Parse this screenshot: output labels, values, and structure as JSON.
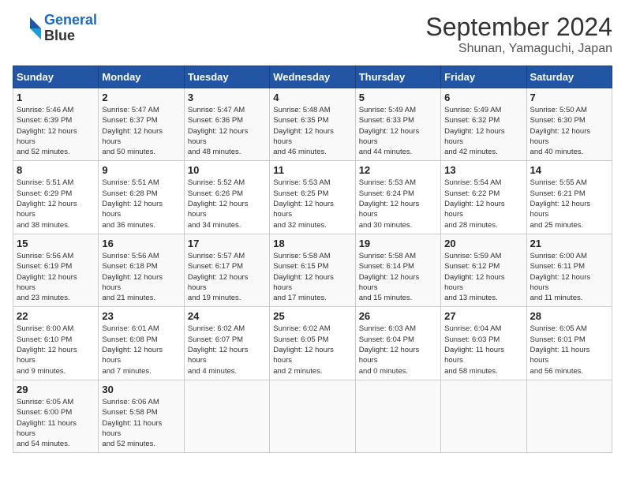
{
  "header": {
    "logo_line1": "General",
    "logo_line2": "Blue",
    "month": "September 2024",
    "location": "Shunan, Yamaguchi, Japan"
  },
  "weekdays": [
    "Sunday",
    "Monday",
    "Tuesday",
    "Wednesday",
    "Thursday",
    "Friday",
    "Saturday"
  ],
  "weeks": [
    [
      {
        "day": "1",
        "rise": "5:46 AM",
        "set": "6:39 PM",
        "daylight": "12 hours and 52 minutes."
      },
      {
        "day": "2",
        "rise": "5:47 AM",
        "set": "6:37 PM",
        "daylight": "12 hours and 50 minutes."
      },
      {
        "day": "3",
        "rise": "5:47 AM",
        "set": "6:36 PM",
        "daylight": "12 hours and 48 minutes."
      },
      {
        "day": "4",
        "rise": "5:48 AM",
        "set": "6:35 PM",
        "daylight": "12 hours and 46 minutes."
      },
      {
        "day": "5",
        "rise": "5:49 AM",
        "set": "6:33 PM",
        "daylight": "12 hours and 44 minutes."
      },
      {
        "day": "6",
        "rise": "5:49 AM",
        "set": "6:32 PM",
        "daylight": "12 hours and 42 minutes."
      },
      {
        "day": "7",
        "rise": "5:50 AM",
        "set": "6:30 PM",
        "daylight": "12 hours and 40 minutes."
      }
    ],
    [
      {
        "day": "8",
        "rise": "5:51 AM",
        "set": "6:29 PM",
        "daylight": "12 hours and 38 minutes."
      },
      {
        "day": "9",
        "rise": "5:51 AM",
        "set": "6:28 PM",
        "daylight": "12 hours and 36 minutes."
      },
      {
        "day": "10",
        "rise": "5:52 AM",
        "set": "6:26 PM",
        "daylight": "12 hours and 34 minutes."
      },
      {
        "day": "11",
        "rise": "5:53 AM",
        "set": "6:25 PM",
        "daylight": "12 hours and 32 minutes."
      },
      {
        "day": "12",
        "rise": "5:53 AM",
        "set": "6:24 PM",
        "daylight": "12 hours and 30 minutes."
      },
      {
        "day": "13",
        "rise": "5:54 AM",
        "set": "6:22 PM",
        "daylight": "12 hours and 28 minutes."
      },
      {
        "day": "14",
        "rise": "5:55 AM",
        "set": "6:21 PM",
        "daylight": "12 hours and 25 minutes."
      }
    ],
    [
      {
        "day": "15",
        "rise": "5:56 AM",
        "set": "6:19 PM",
        "daylight": "12 hours and 23 minutes."
      },
      {
        "day": "16",
        "rise": "5:56 AM",
        "set": "6:18 PM",
        "daylight": "12 hours and 21 minutes."
      },
      {
        "day": "17",
        "rise": "5:57 AM",
        "set": "6:17 PM",
        "daylight": "12 hours and 19 minutes."
      },
      {
        "day": "18",
        "rise": "5:58 AM",
        "set": "6:15 PM",
        "daylight": "12 hours and 17 minutes."
      },
      {
        "day": "19",
        "rise": "5:58 AM",
        "set": "6:14 PM",
        "daylight": "12 hours and 15 minutes."
      },
      {
        "day": "20",
        "rise": "5:59 AM",
        "set": "6:12 PM",
        "daylight": "12 hours and 13 minutes."
      },
      {
        "day": "21",
        "rise": "6:00 AM",
        "set": "6:11 PM",
        "daylight": "12 hours and 11 minutes."
      }
    ],
    [
      {
        "day": "22",
        "rise": "6:00 AM",
        "set": "6:10 PM",
        "daylight": "12 hours and 9 minutes."
      },
      {
        "day": "23",
        "rise": "6:01 AM",
        "set": "6:08 PM",
        "daylight": "12 hours and 7 minutes."
      },
      {
        "day": "24",
        "rise": "6:02 AM",
        "set": "6:07 PM",
        "daylight": "12 hours and 4 minutes."
      },
      {
        "day": "25",
        "rise": "6:02 AM",
        "set": "6:05 PM",
        "daylight": "12 hours and 2 minutes."
      },
      {
        "day": "26",
        "rise": "6:03 AM",
        "set": "6:04 PM",
        "daylight": "12 hours and 0 minutes."
      },
      {
        "day": "27",
        "rise": "6:04 AM",
        "set": "6:03 PM",
        "daylight": "11 hours and 58 minutes."
      },
      {
        "day": "28",
        "rise": "6:05 AM",
        "set": "6:01 PM",
        "daylight": "11 hours and 56 minutes."
      }
    ],
    [
      {
        "day": "29",
        "rise": "6:05 AM",
        "set": "6:00 PM",
        "daylight": "11 hours and 54 minutes."
      },
      {
        "day": "30",
        "rise": "6:06 AM",
        "set": "5:58 PM",
        "daylight": "11 hours and 52 minutes."
      },
      null,
      null,
      null,
      null,
      null
    ]
  ]
}
